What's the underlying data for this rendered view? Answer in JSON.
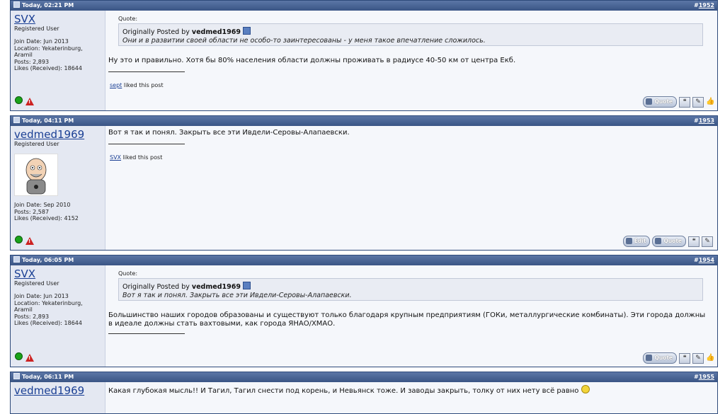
{
  "posts": [
    {
      "date": "Today, 02:21 PM",
      "number": "1952",
      "user": {
        "name": "SVX",
        "title": "Registered User",
        "stats": [
          "Join Date: Jun 2013",
          "Location: Yekaterinburg, Aramil",
          "Posts: 2,893",
          "Likes (Received): 18644"
        ]
      },
      "quote": {
        "label": "Quote:",
        "prefix": "Originally Posted by",
        "author": "vedmed1969",
        "text": "Они и в развитии своей области не особо-то заинтересованы - у меня такое впечатление сложилось."
      },
      "message": "Ну это и правильно. Хотя бы 80% населения области должны проживать в радиусе 40-50 км от центра Екб.",
      "liked_user": "sept",
      "liked_suffix": "liked this post",
      "buttons": [
        "Quote"
      ]
    },
    {
      "date": "Today, 04:11 PM",
      "number": "1953",
      "user": {
        "name": "vedmed1969",
        "title": "Registered User",
        "stats": [
          "Join Date: Sep 2010",
          "Posts: 2,587",
          "Likes (Received): 4152"
        ]
      },
      "message": "Вот я так и понял. Закрыть все эти Ивдели-Серовы-Алапаевски.",
      "liked_user": "SVX",
      "liked_suffix": "liked this post",
      "buttons": [
        "Edit",
        "Quote"
      ]
    },
    {
      "date": "Today, 06:05 PM",
      "number": "1954",
      "user": {
        "name": "SVX",
        "title": "Registered User",
        "stats": [
          "Join Date: Jun 2013",
          "Location: Yekaterinburg, Aramil",
          "Posts: 2,893",
          "Likes (Received): 18644"
        ]
      },
      "quote": {
        "label": "Quote:",
        "prefix": "Originally Posted by",
        "author": "vedmed1969",
        "text": "Вот я так и понял. Закрыть все эти Ивдели-Серовы-Алапаевски."
      },
      "message": "Большинство наших городов образованы и существуют только благодаря крупным предприятиям (ГОКи, металлургические комбинаты). Эти города должны в идеале должны стать вахтовыми, как города ЯНАО/ХМАО.",
      "buttons": [
        "Quote"
      ]
    },
    {
      "date": "Today, 06:11 PM",
      "number": "1955",
      "user": {
        "name": "vedmed1969"
      },
      "message": "Какая глубокая мысль!! И Тагил, Тагил снести под корень, и Невьянск тоже. И заводы закрыть, толку от них нету всё равно"
    }
  ],
  "post_number_prefix": "#"
}
